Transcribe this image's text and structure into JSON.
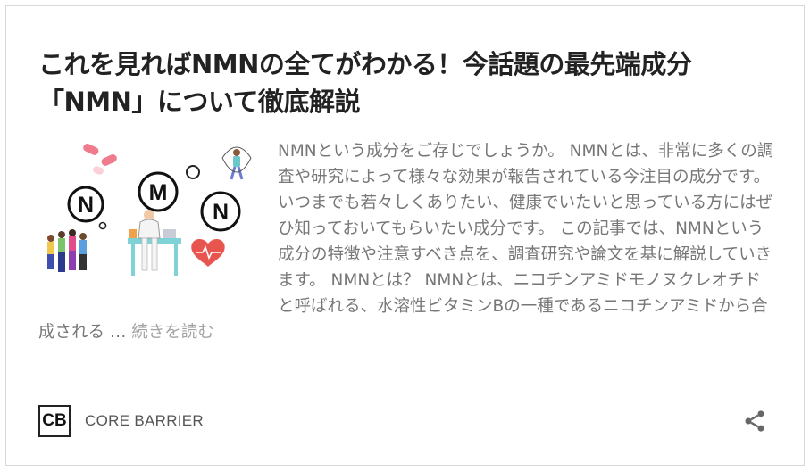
{
  "card": {
    "title": "これを見ればNMNの全てがわかる！今話題の最先端成分「NMN」について徹底解説",
    "thumbnail": {
      "badges": [
        "N",
        "M",
        "N"
      ]
    },
    "excerpt": "NMNという成分をご存じでしょうか。 NMNとは、非常に多くの調査や研究によって様々な効果が報告されている今注目の成分です。 いつまでも若々しくありたい、健康でいたいと思っている方にはぜひ知っておいてもらいたい成分です。 この記事では、NMNという成分の特徴や注意すべき点を、調査研究や論文を基に解説していきます。 NMNとは？ NMNとは、ニコチンアミドモノヌクレオチドと呼ばれる、水溶性ビタミンBの一種であるニコチンアミドから合成される …",
    "read_more": "続きを読む"
  },
  "footer": {
    "logo_text": "CB",
    "site_name": "CORE BARRIER",
    "share_icon": "share-icon"
  },
  "colors": {
    "title": "#222222",
    "excerpt": "#777777",
    "heart": "#e8554e",
    "pill": "#f07b8c",
    "desk": "#7fd3d6"
  }
}
